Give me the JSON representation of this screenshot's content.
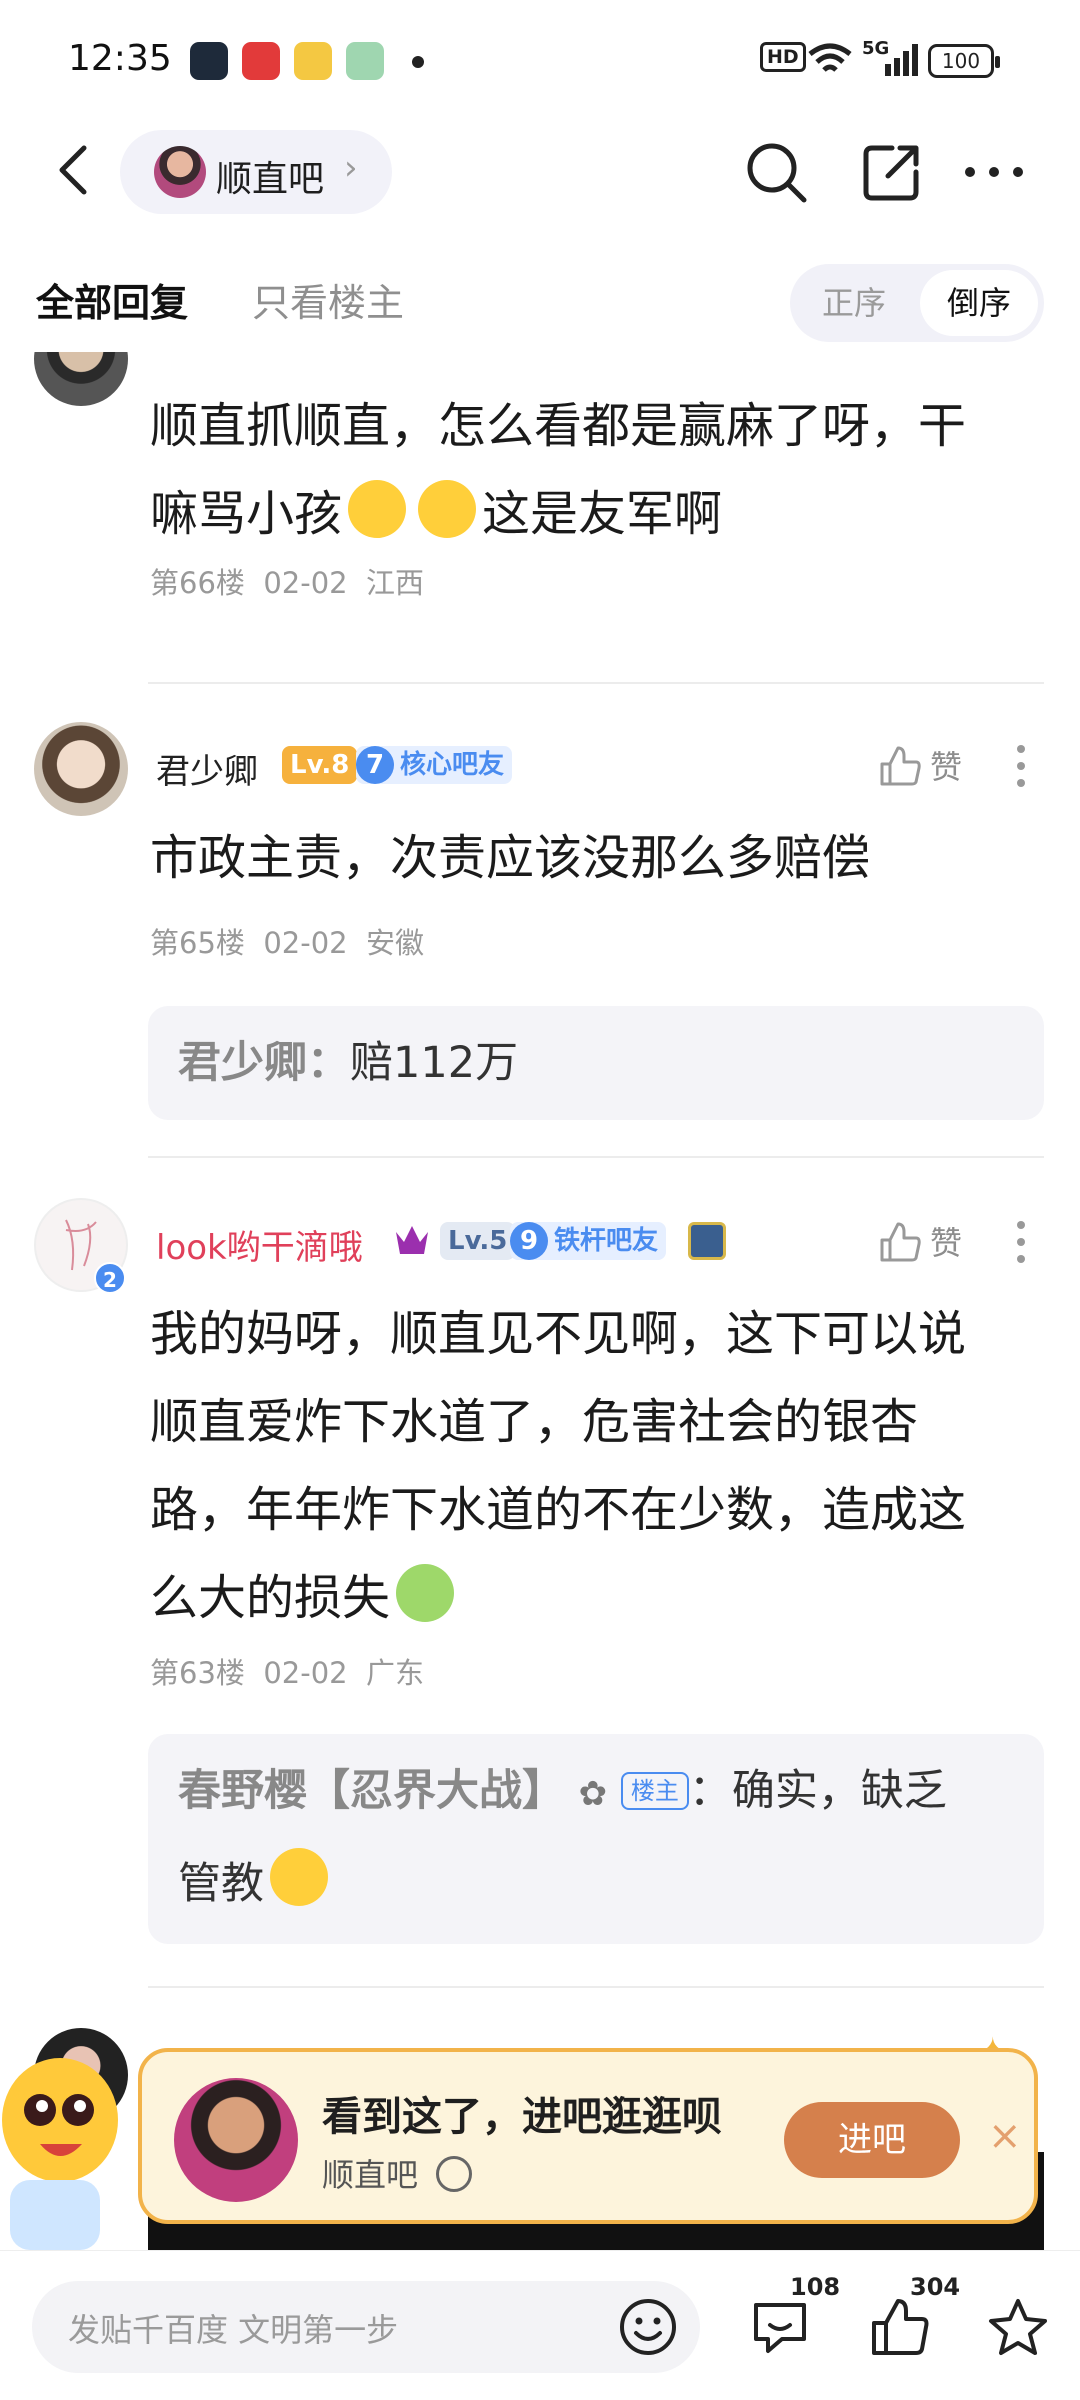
{
  "status_bar": {
    "time": "12:35",
    "network": "5G",
    "hd": "HD",
    "battery": "100"
  },
  "header": {
    "forum_name": "顺直吧",
    "forum_arrow": "›"
  },
  "tabs": {
    "all": "全部回复",
    "op_only": "只看楼主"
  },
  "sort": {
    "asc": "正序",
    "desc": "倒序",
    "selected": "倒序"
  },
  "posts": [
    {
      "text_line1": "顺直抓顺直，怎么看都是赢麻了呀，干",
      "text_line2a": "嘛骂小孩",
      "text_line2b": "这是友军啊",
      "meta": "第66楼  02-02  江西"
    },
    {
      "username": "君少卿",
      "level": "Lv.8",
      "fan_level": "7",
      "fan_title": "核心吧友",
      "like_label": "赞",
      "text": "市政主责，次责应该没那么多赔偿",
      "meta": "第65楼  02-02  安徽",
      "reply": {
        "author": "君少卿",
        "sep": "：",
        "text": "赔112万"
      }
    },
    {
      "username": "look哟干滴哦",
      "level": "Lv.5",
      "fan_level": "9",
      "fan_title": "铁杆吧友",
      "avatar_badge": "2",
      "like_label": "赞",
      "text_lines": [
        "我的妈呀，顺直见不见啊，这下可以说",
        "顺直爱炸下水道了，危害社会的银杏",
        "路，年年炸下水道的不在少数，造成这",
        "么大的损失"
      ],
      "meta": "第63楼  02-02  广东",
      "reply": {
        "author": "春野樱【忍界大战】",
        "op_tag": "楼主",
        "sep": "：",
        "text_line1": "确实，缺乏",
        "text_line2": "管教"
      }
    }
  ],
  "banner": {
    "title": "看到这了，进吧逛逛呗",
    "forum": "顺直吧",
    "button": "进吧",
    "close": "×"
  },
  "bottom_bar": {
    "compose_placeholder": "发贴千百度 文明第一步",
    "comment_count": "108",
    "like_count": "304"
  },
  "colors": {
    "accent": "#d5804c",
    "banner_bg": "#fdf4dc",
    "banner_border": "#f2b34a",
    "vip_name": "#e0405a",
    "fan_badge": "#4a8cf0"
  }
}
